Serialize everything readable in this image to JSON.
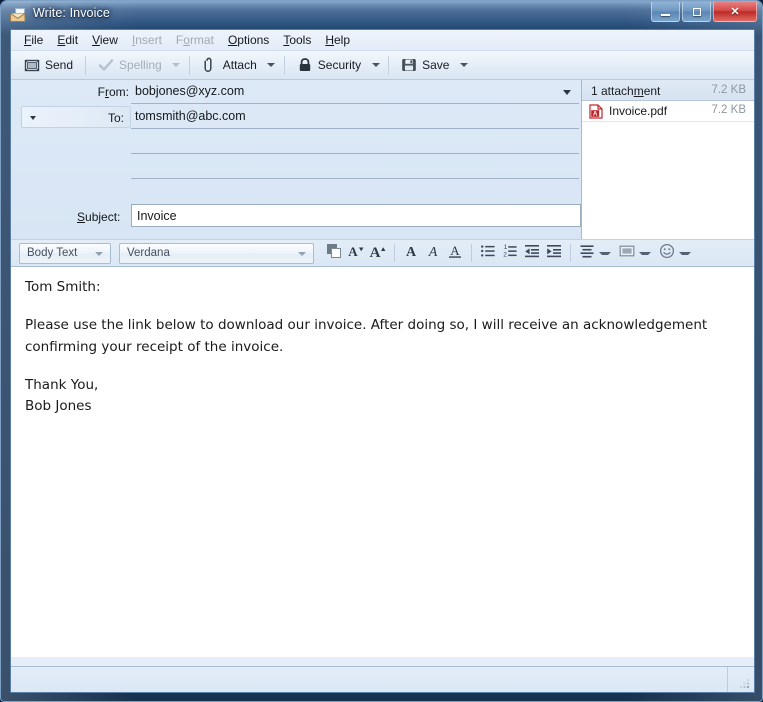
{
  "window": {
    "title": "Write: Invoice",
    "app_icon": "compose-mail-icon",
    "controls": {
      "minimize": "Minimize",
      "maximize": "Maximize",
      "close": "Close"
    }
  },
  "menubar": {
    "items": [
      {
        "label": "File",
        "accel": "F",
        "disabled": false
      },
      {
        "label": "Edit",
        "accel": "E",
        "disabled": false
      },
      {
        "label": "View",
        "accel": "V",
        "disabled": false
      },
      {
        "label": "Insert",
        "accel": "I",
        "disabled": true
      },
      {
        "label": "Format",
        "accel": "o",
        "disabled": true
      },
      {
        "label": "Options",
        "accel": "O",
        "disabled": false
      },
      {
        "label": "Tools",
        "accel": "T",
        "disabled": false
      },
      {
        "label": "Help",
        "accel": "H",
        "disabled": false
      }
    ]
  },
  "toolbar": {
    "send_label": "Send",
    "spelling_label": "Spelling",
    "attach_label": "Attach",
    "security_label": "Security",
    "save_label": "Save"
  },
  "headers": {
    "from": {
      "label": "From:",
      "value": "bobjones@xyz.com"
    },
    "to": {
      "label": "To:",
      "value": "tomsmith@abc.com"
    },
    "empty_rows": 2,
    "subject": {
      "label": "Subject:",
      "value": "Invoice",
      "placeholder": ""
    }
  },
  "attachments": {
    "header_text": "1 attachment",
    "header_size": "7.2 KB",
    "items": [
      {
        "name": "Invoice.pdf",
        "size": "7.2 KB",
        "icon": "pdf-file-icon"
      }
    ]
  },
  "format_toolbar": {
    "paragraph_style": "Body Text",
    "font_family": "Verdana",
    "buttons": [
      "text-color-swatch",
      "decrease-font-size",
      "increase-font-size",
      "bold",
      "italic",
      "underline",
      "bullet-list",
      "numbered-list",
      "outdent",
      "indent",
      "align",
      "highlight-color",
      "insert-smiley"
    ]
  },
  "compose": {
    "paragraphs": [
      "Tom Smith:",
      "Please use the link below to download our invoice.  After doing so, I will receive an acknowledgement confirming your receipt of the invoice.",
      "Thank You,"
    ],
    "signature": "Bob Jones"
  },
  "statusbar": {
    "text": ""
  },
  "colors": {
    "titlebar_dark": "#1b3a60",
    "titlebar_light": "#88a8ca",
    "close_red": "#bc2a26",
    "client_bg": "#e6eff9",
    "headers_bg": "#dce8f6",
    "pdf_red": "#c0272d",
    "text": "#15181c",
    "muted": "#8d97a3"
  }
}
